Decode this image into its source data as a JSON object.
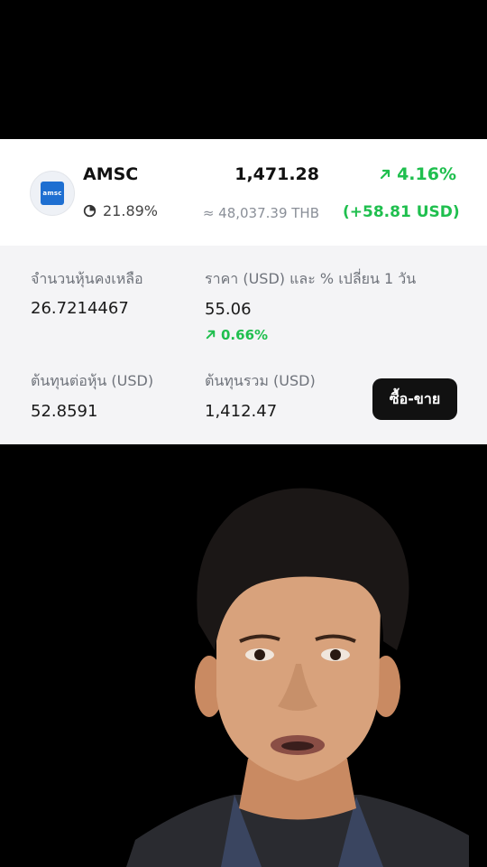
{
  "stock": {
    "ticker": "AMSC",
    "logo_text": "amsc",
    "price": "1,471.28",
    "change_pct": "4.16%",
    "allocation": "21.89%",
    "price_thb": "≈ 48,037.39 THB",
    "change_usd": "(+58.81 USD)"
  },
  "details": {
    "remaining_label": "จำนวนหุ้นคงเหลือ",
    "remaining_value": "26.7214467",
    "price_label": "ราคา (USD) และ % เปลี่ยน 1 วัน",
    "price_value": "55.06",
    "price_change": "0.66%",
    "cost_per_share_label": "ต้นทุนต่อหุ้น (USD)",
    "cost_per_share_value": "52.8591",
    "total_cost_label": "ต้นทุนรวม (USD)",
    "total_cost_value": "1,412.47",
    "trade_button": "ซื้อ-ขาย"
  },
  "colors": {
    "positive": "#1fbf4e",
    "button_bg": "#111111",
    "logo": "#1e6fd1"
  },
  "icons": [
    "pie-chart-icon",
    "arrow-up-right-icon",
    "person-photo"
  ]
}
